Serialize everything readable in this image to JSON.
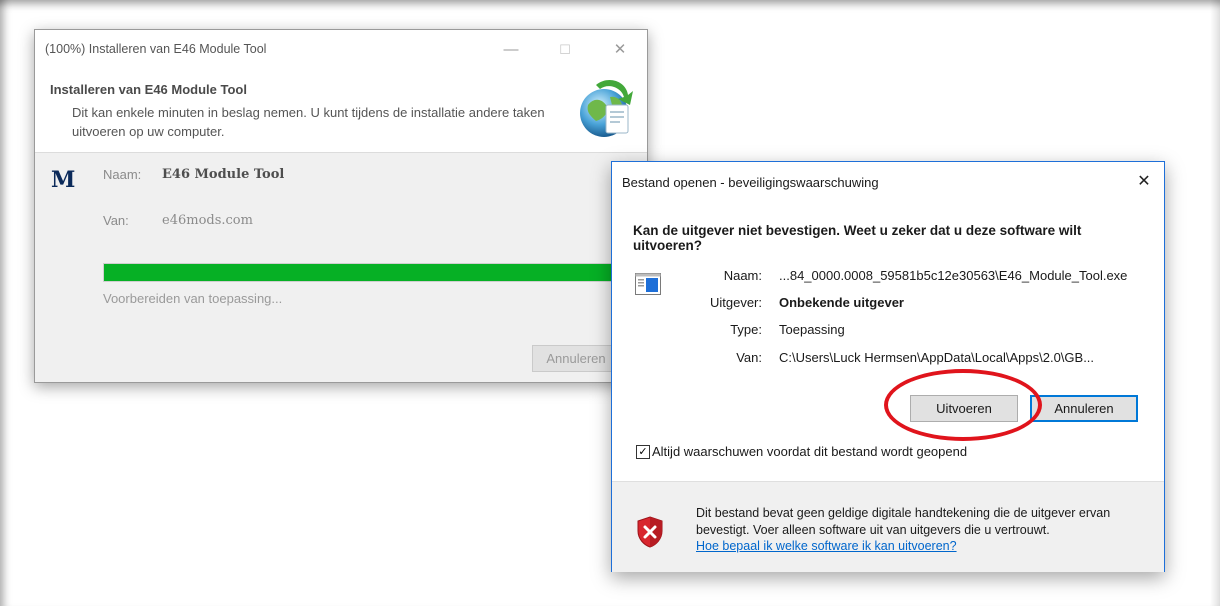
{
  "installer": {
    "title": "(100%) Installeren van E46 Module Tool",
    "controls": {
      "minimize": "—",
      "maximize": "☐",
      "close": "✕"
    },
    "header_title": "Installeren van E46 Module Tool",
    "header_desc": "Dit kan enkele minuten in beslag nemen. U kunt tijdens de installatie andere taken uitvoeren op uw computer.",
    "logo_letter": "M",
    "name_label": "Naam:",
    "name_value": "E46 Module Tool",
    "from_label": "Van:",
    "from_value": "e46mods.com",
    "progress_percent": 100,
    "progress_color": "#06b025",
    "status": "Voorbereiden van toepassing...",
    "cancel_label": "Annuleren"
  },
  "security": {
    "title": "Bestand openen - beveiligingswaarschuwing",
    "close": "✕",
    "question": "Kan de uitgever niet bevestigen. Weet u zeker dat u deze software wilt uitvoeren?",
    "info": {
      "name_label": "Naam:",
      "name_value": "...84_0000.0008_59581b5c12e30563\\E46_Module_Tool.exe",
      "publisher_label": "Uitgever:",
      "publisher_value": "Onbekende uitgever",
      "type_label": "Type:",
      "type_value": "Toepassing",
      "from_label": "Van:",
      "from_value": "C:\\Users\\Luck Hermsen\\AppData\\Local\\Apps\\2.0\\GB..."
    },
    "run_label": "Uitvoeren",
    "cancel_label": "Annuleren",
    "checkbox_checked": true,
    "checkbox_mark": "✓",
    "checkbox_label": "Altijd waarschuwen voordat dit bestand wordt geopend",
    "warning_text": "Dit bestand bevat geen geldige digitale handtekening die de uitgever ervan bevestigt. Voer alleen software uit van uitgevers die u vertrouwt.",
    "help_link": "Hoe bepaal ik welke software ik kan uitvoeren?",
    "accent_color": "#0078d7",
    "annotation_color": "#e0141c"
  }
}
